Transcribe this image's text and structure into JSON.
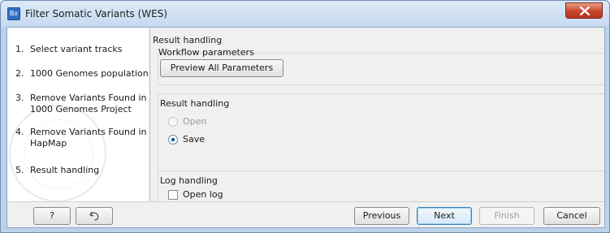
{
  "window": {
    "title": "Filter Somatic Variants (WES)",
    "app_icon_text": "Bx"
  },
  "steps": [
    {
      "num": "1.",
      "label": "Select variant tracks"
    },
    {
      "num": "2.",
      "label": "1000 Genomes population"
    },
    {
      "num": "3.",
      "label": "Remove Variants Found in 1000 Genomes Project"
    },
    {
      "num": "4.",
      "label": "Remove Variants Found in HapMap"
    },
    {
      "num": "5.",
      "label": "Result handling"
    }
  ],
  "content": {
    "section_title": "Result handling",
    "workflow": {
      "label": "Workflow parameters",
      "preview_button": "Preview All Parameters"
    },
    "result": {
      "label": "Result handling",
      "open_label": "Open",
      "save_label": "Save",
      "selected": "Save"
    },
    "log": {
      "label": "Log handling",
      "open_log_label": "Open log"
    }
  },
  "footer": {
    "help": "?",
    "previous": "Previous",
    "next": "Next",
    "finish": "Finish",
    "cancel": "Cancel"
  }
}
